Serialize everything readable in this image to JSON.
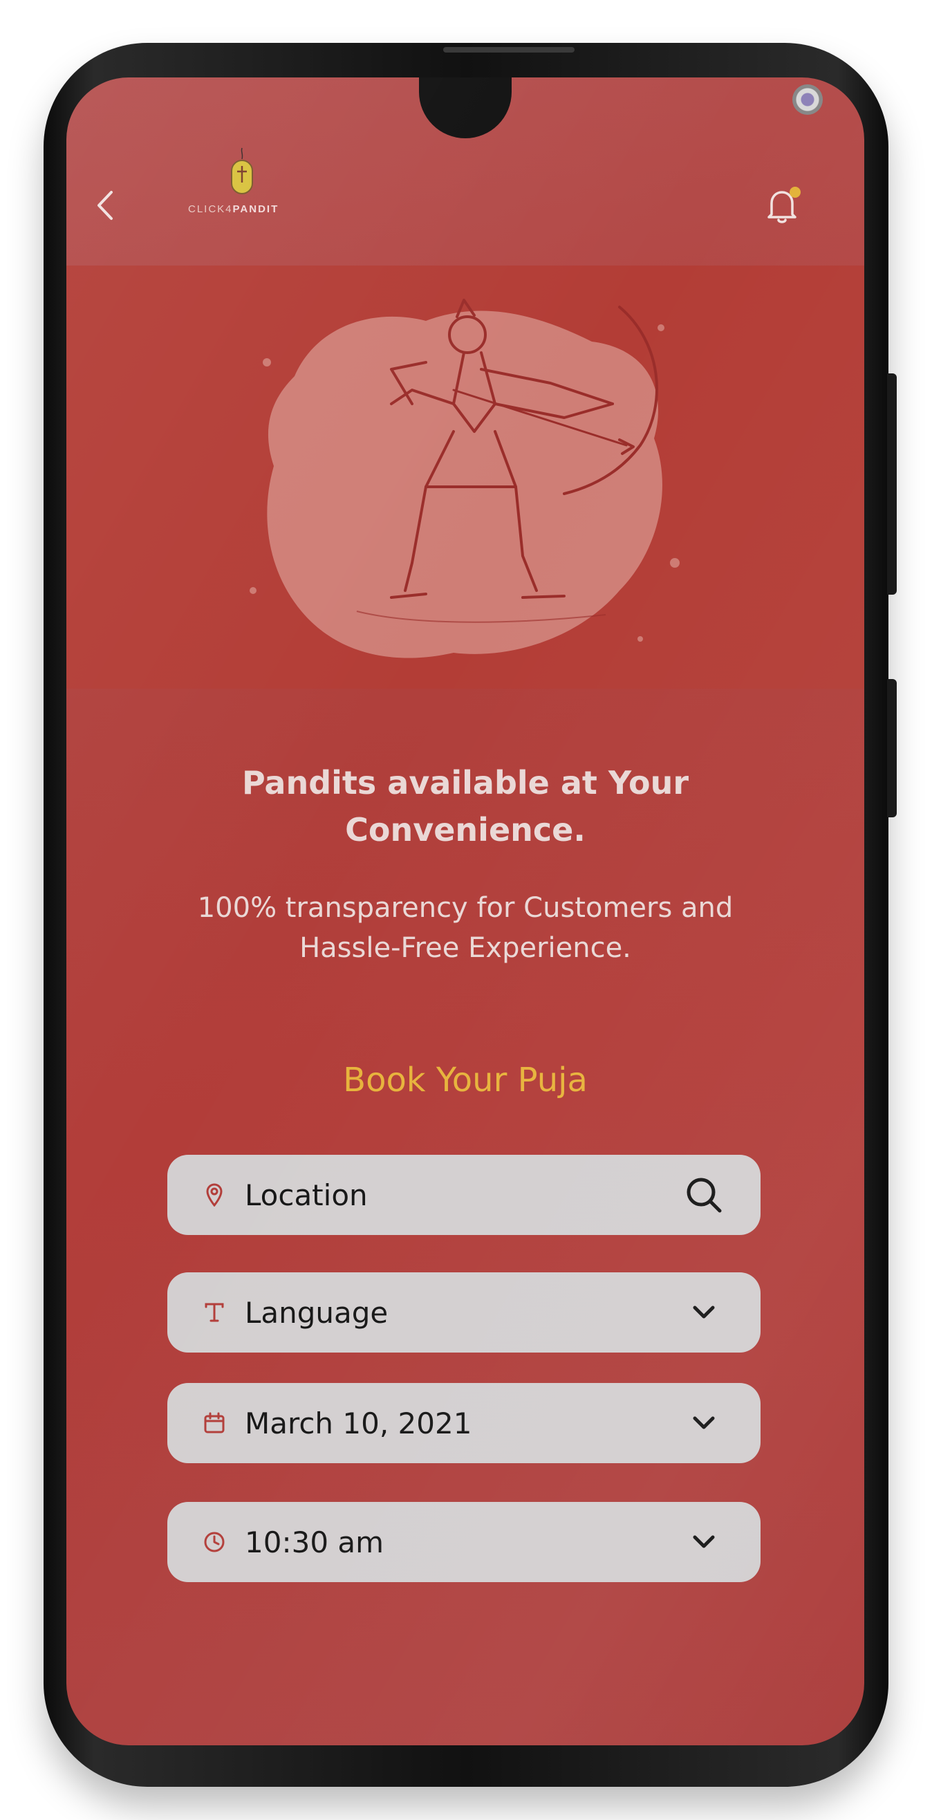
{
  "header": {
    "back_icon": "chevron-left-icon",
    "logo": {
      "text_regular": "CLICK4",
      "text_bold": "PANDIT"
    },
    "notification_icon": "bell-icon",
    "notification_badge_color": "#e3b33b"
  },
  "hero": {
    "image": "lord-rama-archer-illustration"
  },
  "content": {
    "headline": "Pandits available at Your Convenience.",
    "subline": "100% transparency for Customers and Hassle-Free Experience.",
    "section_title": "Book Your Puja"
  },
  "form": {
    "location": {
      "value": "Location",
      "icon": "map-pin-icon",
      "action_icon": "search-icon"
    },
    "language": {
      "value": "Language",
      "icon": "text-icon",
      "action_icon": "chevron-down-icon"
    },
    "date": {
      "value": "March 10, 2021",
      "icon": "calendar-icon",
      "action_icon": "chevron-down-icon"
    },
    "time": {
      "value": "10:30 am",
      "icon": "clock-icon",
      "action_icon": "chevron-down-icon"
    }
  },
  "colors": {
    "background": "#b23d39",
    "accent": "#e7b33b",
    "field": "#d3cfd0",
    "icon": "#b23d39"
  }
}
